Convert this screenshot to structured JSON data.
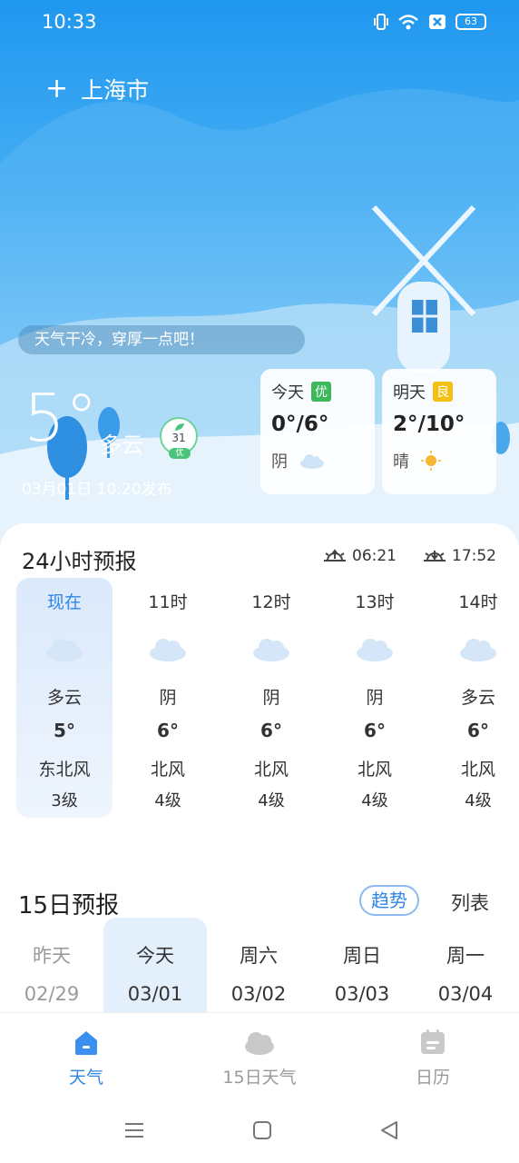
{
  "status": {
    "time": "10:33",
    "battery": "63"
  },
  "header": {
    "city": "上海市",
    "add_label": "+"
  },
  "current": {
    "tip": "天气干冷，穿厚一点吧！",
    "temp": "5°",
    "condition": "多云",
    "aqi_value": "31",
    "aqi_level": "优",
    "publish_time": "03月01日 10:20发布"
  },
  "forecast_cards": [
    {
      "label": "今天",
      "badge": "优",
      "badge_color": "#3cb95b",
      "range": "0°/6°",
      "condition": "阴",
      "icon": "cloud-icon"
    },
    {
      "label": "明天",
      "badge": "良",
      "badge_color": "#f2c014",
      "range": "2°/10°",
      "condition": "晴",
      "icon": "sun-icon"
    }
  ],
  "hourly": {
    "title": "24小时预报",
    "sunrise": "06:21",
    "sunset": "17:52",
    "items": [
      {
        "hour": "现在",
        "condition": "多云",
        "temp": "5°",
        "wind": "东北风",
        "level": "3级"
      },
      {
        "hour": "11时",
        "condition": "阴",
        "temp": "6°",
        "wind": "北风",
        "level": "4级"
      },
      {
        "hour": "12时",
        "condition": "阴",
        "temp": "6°",
        "wind": "北风",
        "level": "4级"
      },
      {
        "hour": "13时",
        "condition": "阴",
        "temp": "6°",
        "wind": "北风",
        "level": "4级"
      },
      {
        "hour": "14时",
        "condition": "多云",
        "temp": "6°",
        "wind": "北风",
        "level": "4级"
      }
    ]
  },
  "daily": {
    "title": "15日预报",
    "trend_label": "趋势",
    "list_label": "列表",
    "items": [
      {
        "day": "昨天",
        "date": "02/29"
      },
      {
        "day": "今天",
        "date": "03/01"
      },
      {
        "day": "周六",
        "date": "03/02"
      },
      {
        "day": "周日",
        "date": "03/03"
      },
      {
        "day": "周一",
        "date": "03/04"
      }
    ]
  },
  "tabs": [
    {
      "label": "天气",
      "icon": "home-icon"
    },
    {
      "label": "15日天气",
      "icon": "cloud-icon"
    },
    {
      "label": "日历",
      "icon": "calendar-icon"
    }
  ],
  "colors": {
    "accent": "#2f86e6",
    "sky_top": "#1f97ef",
    "aqi_good": "#4bc47a"
  }
}
